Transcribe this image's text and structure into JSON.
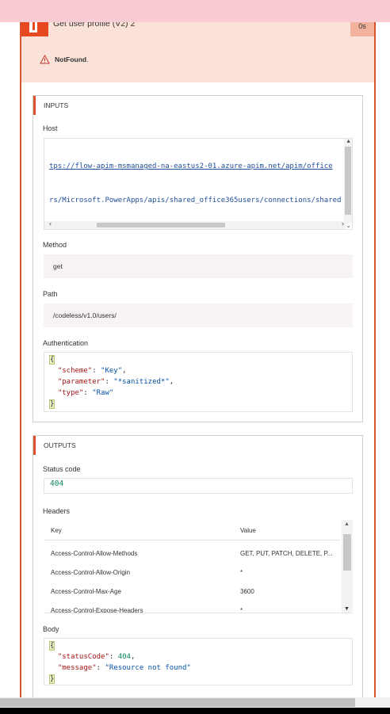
{
  "action": {
    "title": "Get user profile (V2) 2",
    "duration": "0s",
    "error_code": "NotFound",
    "error_suffix": "."
  },
  "inputs": {
    "section_title": "INPUTS",
    "host_label": "Host",
    "host_line1": "tps://flow-apim-msmanaged-na-eastus2-01.azure-apim.net/apim/office",
    "host_line2": "rs/Microsoft.PowerApps/apis/shared_office365users/connections/shared",
    "method_label": "Method",
    "method_value": "get",
    "path_label": "Path",
    "path_value": "/codeless/v1.0/users/",
    "auth_label": "Authentication",
    "auth_code": {
      "open": "{",
      "scheme_key": "\"scheme\"",
      "scheme_val": "\"Key\"",
      "parameter_key": "\"parameter\"",
      "parameter_val": "\"*sanitized*\"",
      "type_key": "\"type\"",
      "type_val": "\"Raw\"",
      "close": "}"
    }
  },
  "outputs": {
    "section_title": "OUTPUTS",
    "status_label": "Status code",
    "status_value": "404",
    "headers_label": "Headers",
    "headers_columns": {
      "key": "Key",
      "value": "Value"
    },
    "headers_rows": [
      {
        "key": "Access-Control-Allow-Methods",
        "value": "GET, PUT, PATCH, DELETE, P..."
      },
      {
        "key": "Access-Control-Allow-Origin",
        "value": "*"
      },
      {
        "key": "Access-Control-Max-Age",
        "value": "3600"
      },
      {
        "key": "Access-Control-Expose-Headers",
        "value": "*"
      }
    ],
    "body_label": "Body",
    "body_code": {
      "open": "{",
      "status_key": "\"statusCode\"",
      "status_val": "404",
      "message_key": "\"message\"",
      "message_val": "\"Resource not found\"",
      "close": "}"
    }
  },
  "colors": {
    "accent": "#d9542b",
    "header_bg": "#fbe2d9",
    "banner": "#f9ccd4",
    "office_logo": "#e8481f"
  },
  "icons": {
    "warning": "warning-icon",
    "logo": "office-logo-icon"
  }
}
